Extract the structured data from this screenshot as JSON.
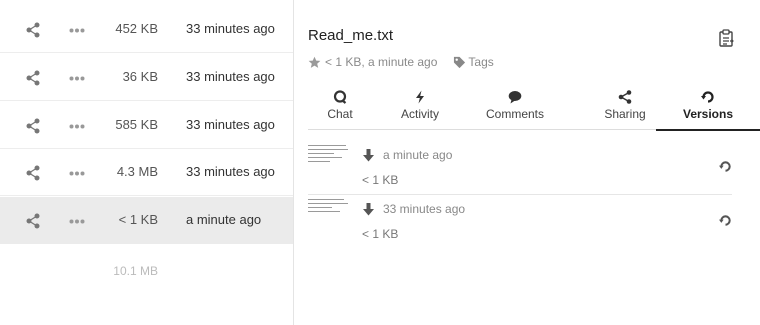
{
  "file_list": {
    "rows": [
      {
        "size": "452 KB",
        "modified": "33 minutes ago"
      },
      {
        "size": "36 KB",
        "modified": "33 minutes ago"
      },
      {
        "size": "585 KB",
        "modified": "33 minutes ago"
      },
      {
        "size": "4.3 MB",
        "modified": "33 minutes ago"
      },
      {
        "size": "< 1 KB",
        "modified": "a minute ago"
      }
    ],
    "total_size": "10.1 MB",
    "row_icons": [
      "share-icon",
      "more-icon"
    ]
  },
  "sidebar": {
    "filename": "Read_me.txt",
    "meta": "< 1 KB, a minute ago",
    "tags_label": "Tags",
    "tabs": [
      {
        "label": "Chat",
        "icon": "chat-icon"
      },
      {
        "label": "Activity",
        "icon": "activity-icon"
      },
      {
        "label": "Comments",
        "icon": "comments-icon"
      },
      {
        "label": "Sharing",
        "icon": "share-icon"
      },
      {
        "label": "Versions",
        "icon": "versions-icon",
        "active": true
      }
    ],
    "versions": [
      {
        "time": "a minute ago",
        "size": "< 1 KB"
      },
      {
        "time": "33 minutes ago",
        "size": "< 1 KB"
      }
    ]
  },
  "colors": {
    "selected_row": "#ebebeb",
    "active_tab_underline": "#222222"
  }
}
